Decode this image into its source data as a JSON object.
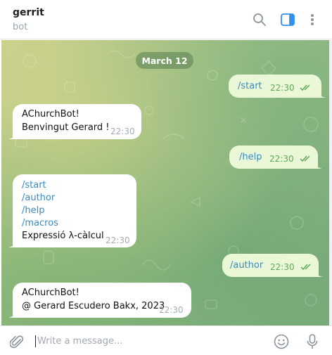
{
  "header": {
    "title": "gerrit",
    "status": "bot",
    "icons": [
      "search-icon",
      "sidebar-toggle-icon",
      "more-vertical-icon"
    ],
    "accent_color": "#3390ec"
  },
  "chat": {
    "date_label": "March 12",
    "messages": [
      {
        "direction": "out",
        "text": "/start",
        "time": "22:30",
        "read": true
      },
      {
        "direction": "in",
        "lines": [
          "AChurchBot!",
          "Benvingut Gerard !"
        ],
        "time": "22:30"
      },
      {
        "direction": "out",
        "text": "/help",
        "time": "22:30",
        "read": true
      },
      {
        "direction": "in",
        "lines": [
          "/start",
          "/author",
          "/help",
          "/macros",
          "Expressió λ-càlcul"
        ],
        "time": "22:30"
      },
      {
        "direction": "out",
        "text": "/author",
        "time": "22:30",
        "read": true
      },
      {
        "direction": "in",
        "lines": [
          "AChurchBot!",
          "@ Gerard Escudero Bakx, 2023"
        ],
        "time": "22:30"
      }
    ]
  },
  "composer": {
    "placeholder": "Write a message...",
    "icons": [
      "paperclip-icon",
      "emoji-icon",
      "microphone-icon"
    ]
  },
  "colors": {
    "outgoing_bubble": "#eaf8d8",
    "incoming_bubble": "#ffffff",
    "command_link": "#3a8bbf",
    "read_ticks": "#5fa85a"
  }
}
